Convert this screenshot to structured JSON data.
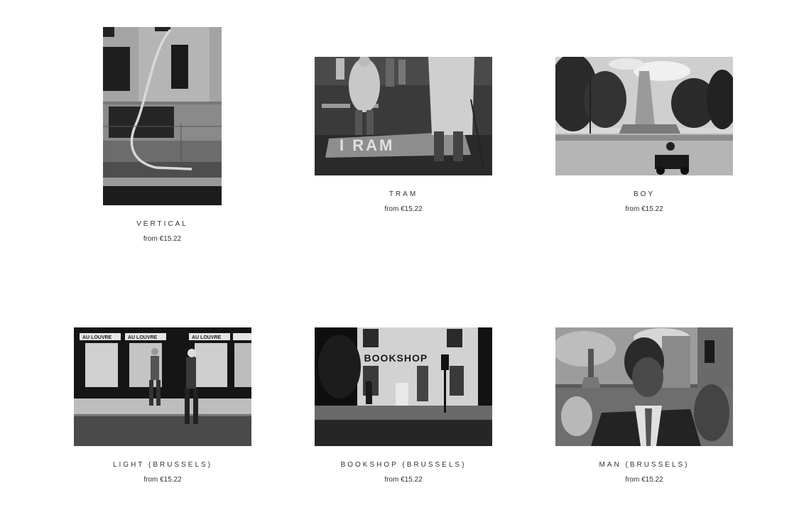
{
  "products": [
    {
      "title": "VERTICAL",
      "price": "from €15.22",
      "image_icon": "photo-building-wall-pipe"
    },
    {
      "title": "TRAM",
      "price": "from €15.22",
      "image_icon": "photo-tram-crossing"
    },
    {
      "title": "BOY",
      "price": "from €15.22",
      "image_icon": "photo-statue-boy-car"
    },
    {
      "title": "LIGHT (BRUSSELS)",
      "price": "from €15.22",
      "image_icon": "photo-au-louvre-street"
    },
    {
      "title": "BOOKSHOP (BRUSSELS)",
      "price": "from €15.22",
      "image_icon": "photo-bookshop-facade"
    },
    {
      "title": "MAN (BRUSSELS)",
      "price": "from €15.22",
      "image_icon": "photo-man-crowd"
    }
  ]
}
